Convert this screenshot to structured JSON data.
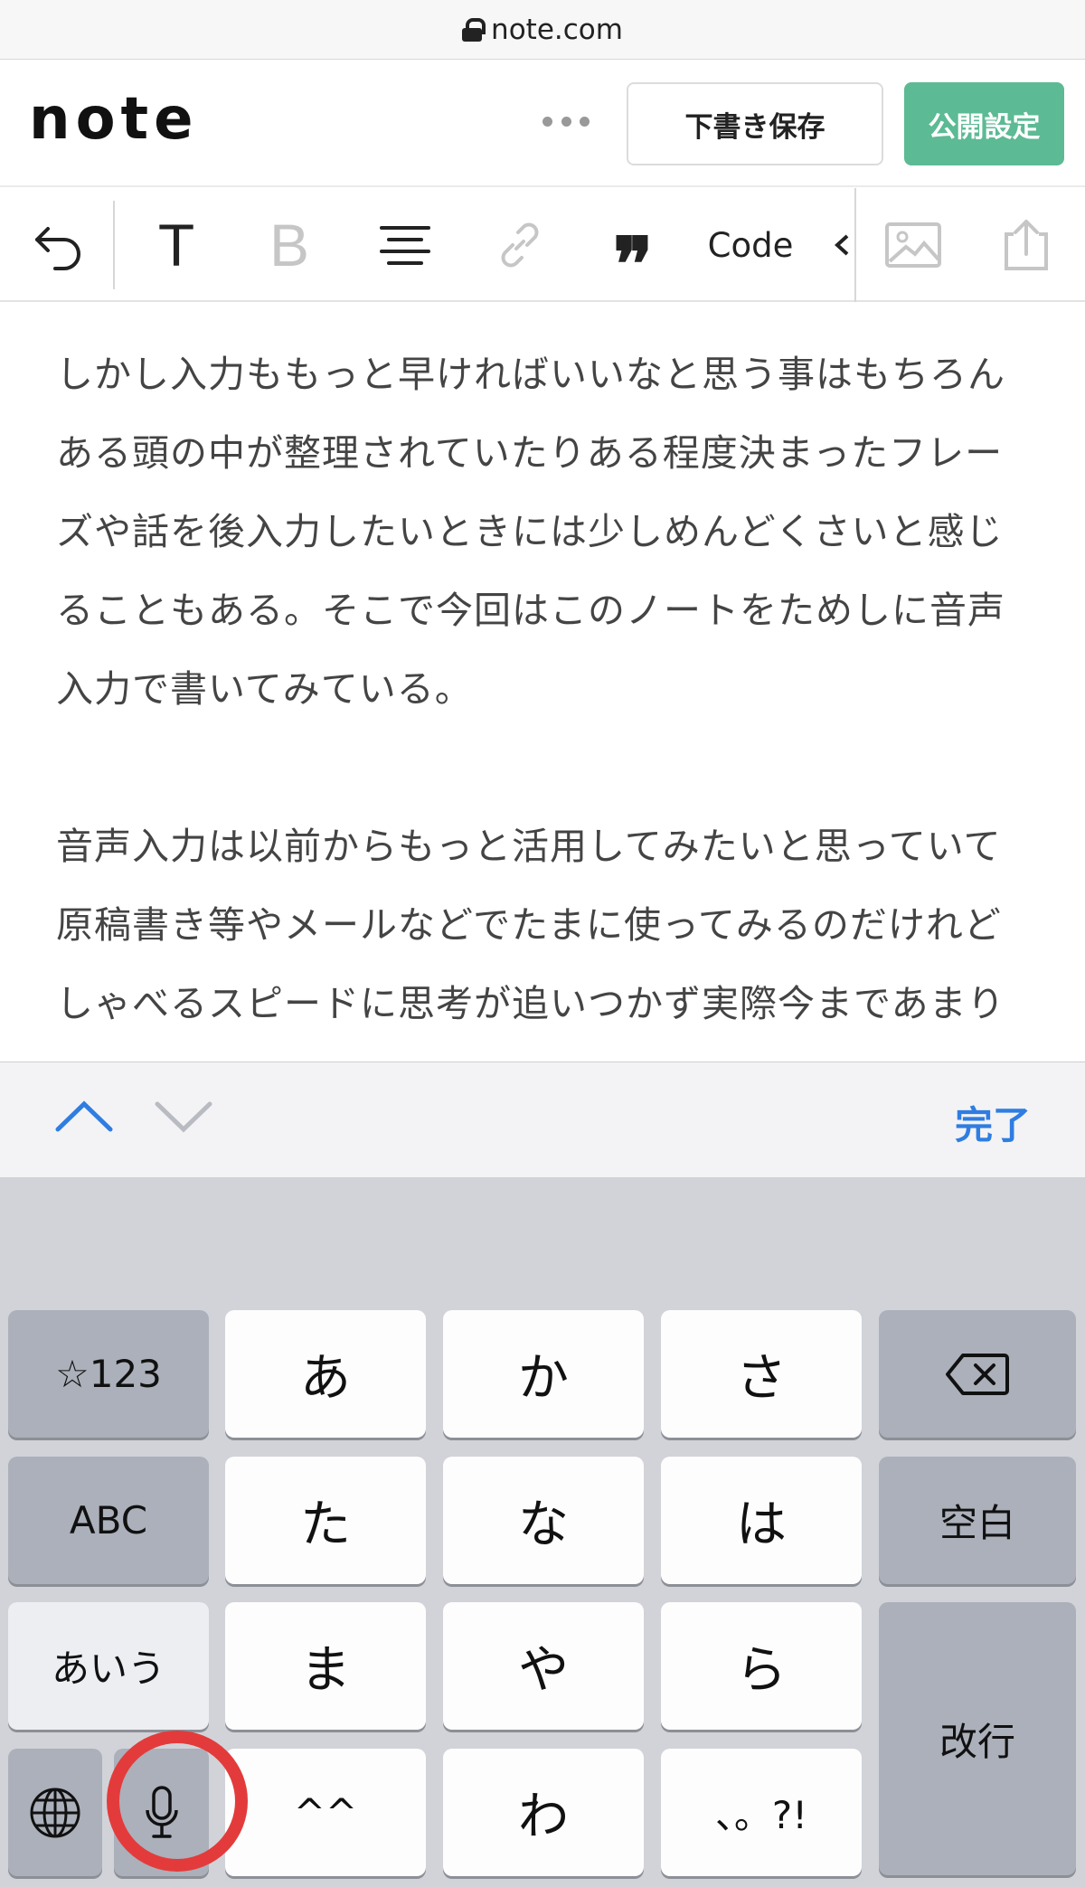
{
  "browser": {
    "url": "note.com"
  },
  "header": {
    "logo": "note",
    "draft_label": "下書き保存",
    "publish_label": "公開設定",
    "publish_color": "#5cba94"
  },
  "toolbar": {
    "text_label": "T",
    "bold_label": "B",
    "quote_label": "❞",
    "code_label": "Code"
  },
  "article": {
    "paragraph1": "しかし入力ももっと早ければいいなと思う事はもちろんある頭の中が整理されていたりある程度決まったフレーズや話を後入力したいときには少しめんどくさいと感じることもある。そこで今回はこのノートをためしに音声入力で書いてみている。",
    "paragraph2": "音声入力は以前からもっと活用してみたいと思っていて原稿書き等やメールなどでたまに使ってみるのだけれどしゃべるスピードに思考が追いつかず実際今まであまり活用できていない。"
  },
  "accessory": {
    "done_label": "完了",
    "accent_color": "#2f7de1"
  },
  "keyboard": {
    "row1": {
      "left": "☆123",
      "k1": "あ",
      "k2": "か",
      "k3": "さ"
    },
    "row2": {
      "left": "ABC",
      "k1": "た",
      "k2": "な",
      "k3": "は",
      "right": "空白"
    },
    "row3": {
      "left": "あいう",
      "k1": "ま",
      "k2": "や",
      "k3": "ら",
      "right": "改行"
    },
    "row4": {
      "k1": "^^",
      "k2": "わ",
      "k3": "、。?!"
    },
    "highlight_color": "#e33b3b"
  }
}
